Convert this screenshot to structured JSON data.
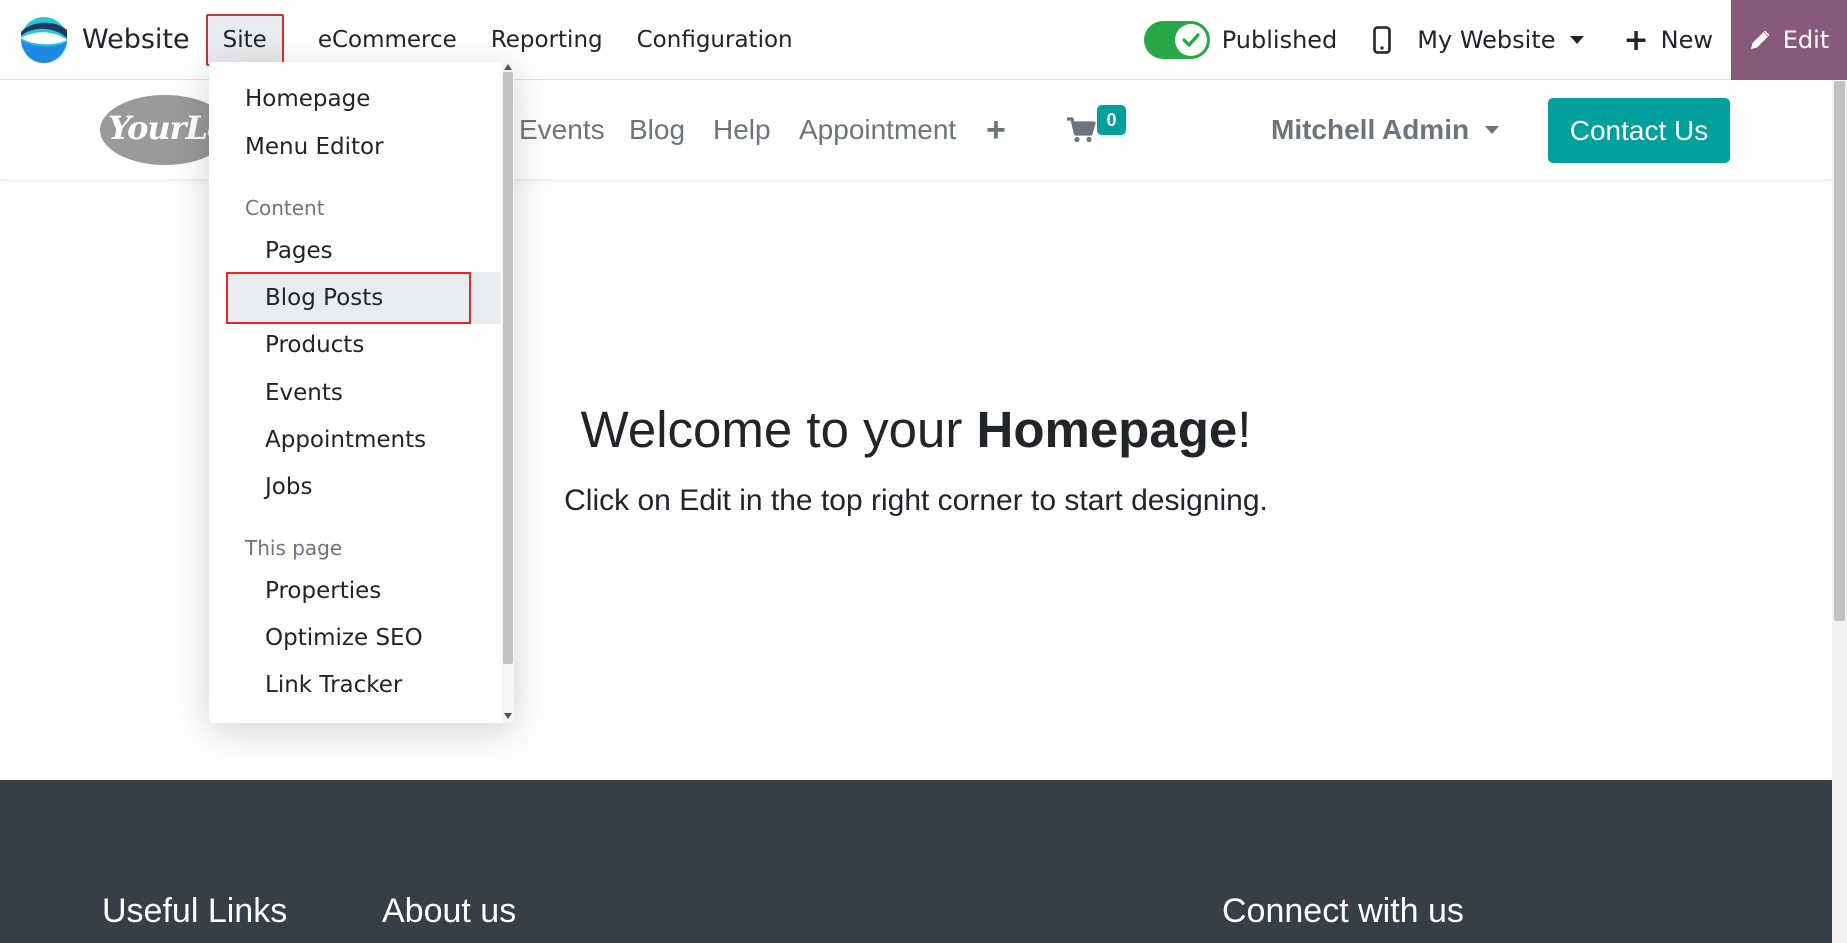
{
  "topbar": {
    "app_name": "Website",
    "menus": [
      "Site",
      "eCommerce",
      "Reporting",
      "Configuration"
    ],
    "published_label": "Published",
    "published_state": true,
    "website_selector": "My Website",
    "new_label": "New",
    "edit_label": "Edit"
  },
  "site_header": {
    "logo_text": "YourLo",
    "nav_items": [
      "Events",
      "Blog",
      "Help",
      "Appointment"
    ],
    "cart_count": "0",
    "user_name": "Mitchell Admin",
    "contact_label": "Contact Us"
  },
  "hero": {
    "title_prefix": "Welcome to your ",
    "title_bold": "Homepage",
    "title_suffix": "!",
    "sub_prefix": "Click on ",
    "sub_bold": "Edit",
    "sub_suffix": " in the top right corner to start designing."
  },
  "footer": {
    "columns": [
      "Useful Links",
      "About us",
      "Connect with us"
    ]
  },
  "site_menu": {
    "top_items": [
      "Homepage",
      "Menu Editor"
    ],
    "content_header": "Content",
    "content_items": [
      "Pages",
      "Blog Posts",
      "Products",
      "Events",
      "Appointments",
      "Jobs"
    ],
    "page_header": "This page",
    "page_items": [
      "Properties",
      "Optimize SEO",
      "Link Tracker"
    ],
    "highlighted_item": "Blog Posts"
  },
  "colors": {
    "edit_bg": "#875a7b",
    "accent_teal": "#00a09d",
    "toggle_green": "#28a745",
    "highlight_red": "#e02b2b",
    "footer_bg": "#383e45"
  }
}
